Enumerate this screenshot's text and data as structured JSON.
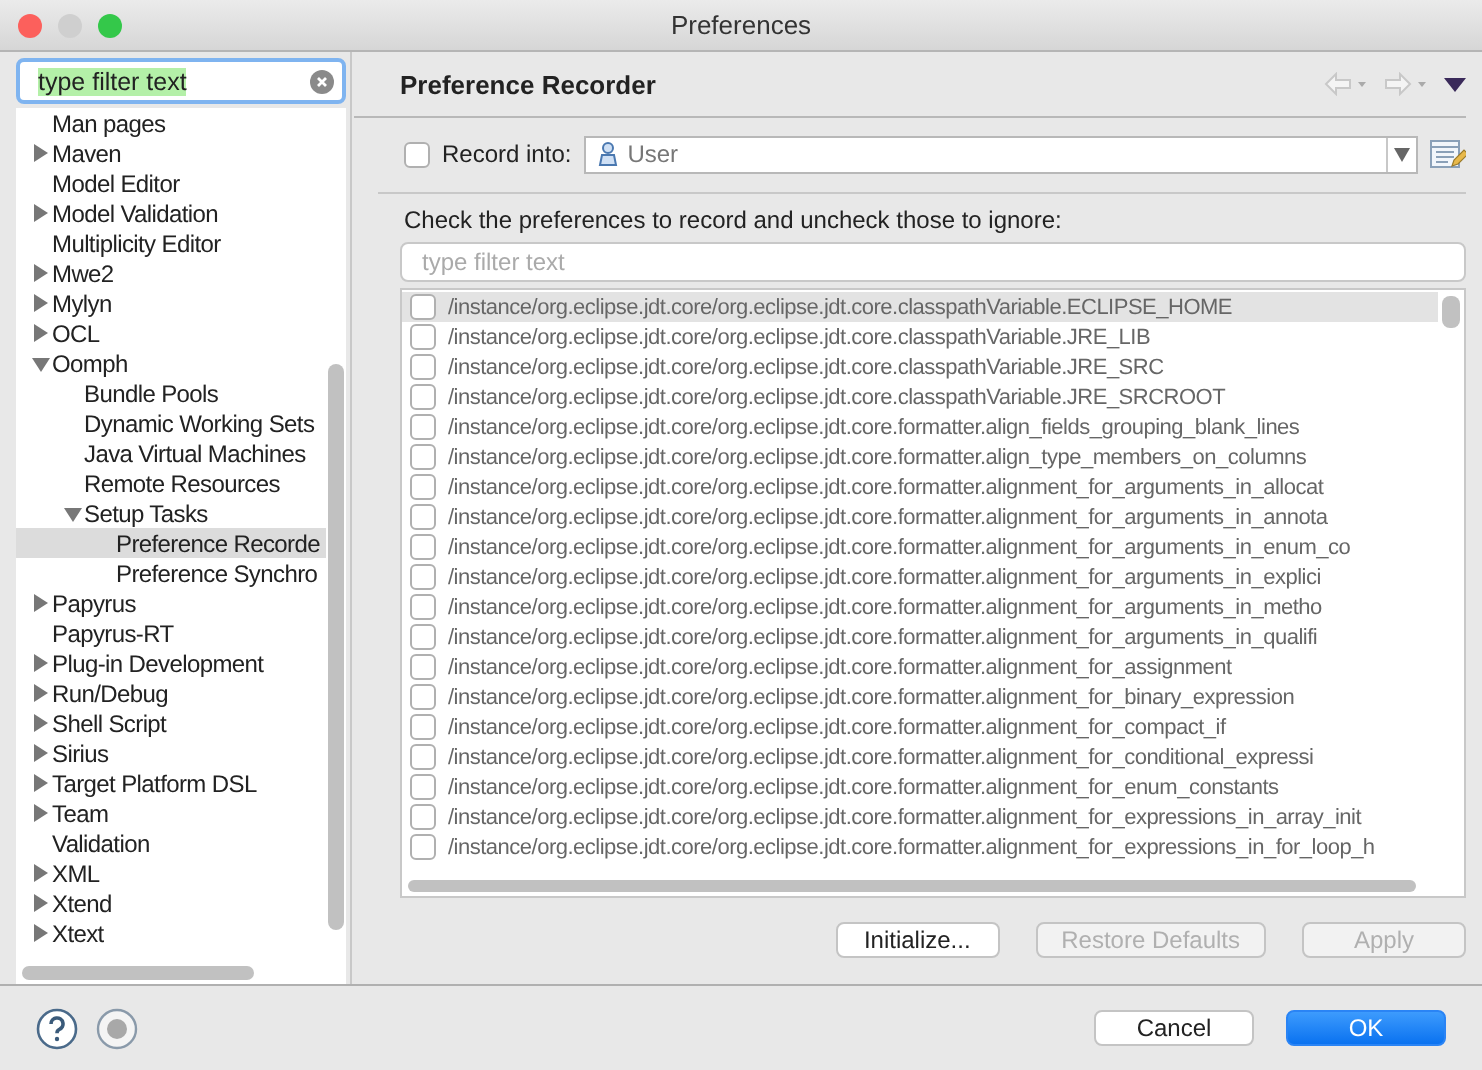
{
  "window": {
    "title": "Preferences"
  },
  "sidebar": {
    "filter": {
      "value": "type filter text"
    },
    "tree": [
      {
        "label": "Man pages"
      },
      {
        "label": "Maven",
        "expanded": false
      },
      {
        "label": "Model Editor"
      },
      {
        "label": "Model Validation",
        "expanded": false
      },
      {
        "label": "Multiplicity Editor"
      },
      {
        "label": "Mwe2",
        "expanded": false
      },
      {
        "label": "Mylyn",
        "expanded": false
      },
      {
        "label": "OCL",
        "expanded": false
      },
      {
        "label": "Oomph",
        "expanded": true,
        "children": [
          {
            "label": "Bundle Pools"
          },
          {
            "label": "Dynamic Working Sets"
          },
          {
            "label": "Java Virtual Machines"
          },
          {
            "label": "Remote Resources"
          },
          {
            "label": "Setup Tasks",
            "expanded": true,
            "children": [
              {
                "label": "Preference Recorde",
                "selected": true
              },
              {
                "label": "Preference Synchro",
                "selected": false
              }
            ]
          }
        ]
      },
      {
        "label": "Papyrus",
        "expanded": false
      },
      {
        "label": "Papyrus-RT"
      },
      {
        "label": "Plug-in Development",
        "expanded": false
      },
      {
        "label": "Run/Debug",
        "expanded": false
      },
      {
        "label": "Shell Script",
        "expanded": false
      },
      {
        "label": "Sirius",
        "expanded": false
      },
      {
        "label": "Target Platform DSL",
        "expanded": false
      },
      {
        "label": "Team",
        "expanded": false
      },
      {
        "label": "Validation"
      },
      {
        "label": "XML",
        "expanded": false
      },
      {
        "label": "Xtend",
        "expanded": false
      },
      {
        "label": "Xtext",
        "expanded": false
      }
    ]
  },
  "page": {
    "title": "Preference Recorder",
    "record": {
      "label": "Record into:",
      "checked": false,
      "target": "User"
    },
    "instruction": "Check the preferences to record and uncheck those to ignore:",
    "filter": {
      "placeholder": "type filter text"
    },
    "preferences": [
      {
        "path": "/instance/org.eclipse.jdt.core/org.eclipse.jdt.core.classpathVariable.ECLIPSE_HOME",
        "checked": false,
        "selected": true
      },
      {
        "path": "/instance/org.eclipse.jdt.core/org.eclipse.jdt.core.classpathVariable.JRE_LIB",
        "checked": false,
        "selected": false
      },
      {
        "path": "/instance/org.eclipse.jdt.core/org.eclipse.jdt.core.classpathVariable.JRE_SRC",
        "checked": false,
        "selected": false
      },
      {
        "path": "/instance/org.eclipse.jdt.core/org.eclipse.jdt.core.classpathVariable.JRE_SRCROOT",
        "checked": false,
        "selected": false
      },
      {
        "path": "/instance/org.eclipse.jdt.core/org.eclipse.jdt.core.formatter.align_fields_grouping_blank_lines",
        "checked": false,
        "selected": false
      },
      {
        "path": "/instance/org.eclipse.jdt.core/org.eclipse.jdt.core.formatter.align_type_members_on_columns",
        "checked": false,
        "selected": false
      },
      {
        "path": "/instance/org.eclipse.jdt.core/org.eclipse.jdt.core.formatter.alignment_for_arguments_in_allocat",
        "checked": false,
        "selected": false
      },
      {
        "path": "/instance/org.eclipse.jdt.core/org.eclipse.jdt.core.formatter.alignment_for_arguments_in_annota",
        "checked": false,
        "selected": false
      },
      {
        "path": "/instance/org.eclipse.jdt.core/org.eclipse.jdt.core.formatter.alignment_for_arguments_in_enum_co",
        "checked": false,
        "selected": false
      },
      {
        "path": "/instance/org.eclipse.jdt.core/org.eclipse.jdt.core.formatter.alignment_for_arguments_in_explici",
        "checked": false,
        "selected": false
      },
      {
        "path": "/instance/org.eclipse.jdt.core/org.eclipse.jdt.core.formatter.alignment_for_arguments_in_metho",
        "checked": false,
        "selected": false
      },
      {
        "path": "/instance/org.eclipse.jdt.core/org.eclipse.jdt.core.formatter.alignment_for_arguments_in_qualifi",
        "checked": false,
        "selected": false
      },
      {
        "path": "/instance/org.eclipse.jdt.core/org.eclipse.jdt.core.formatter.alignment_for_assignment",
        "checked": false,
        "selected": false
      },
      {
        "path": "/instance/org.eclipse.jdt.core/org.eclipse.jdt.core.formatter.alignment_for_binary_expression",
        "checked": false,
        "selected": false
      },
      {
        "path": "/instance/org.eclipse.jdt.core/org.eclipse.jdt.core.formatter.alignment_for_compact_if",
        "checked": false,
        "selected": false
      },
      {
        "path": "/instance/org.eclipse.jdt.core/org.eclipse.jdt.core.formatter.alignment_for_conditional_expressi",
        "checked": false,
        "selected": false
      },
      {
        "path": "/instance/org.eclipse.jdt.core/org.eclipse.jdt.core.formatter.alignment_for_enum_constants",
        "checked": false,
        "selected": false
      },
      {
        "path": "/instance/org.eclipse.jdt.core/org.eclipse.jdt.core.formatter.alignment_for_expressions_in_array_init",
        "checked": false,
        "selected": false
      },
      {
        "path": "/instance/org.eclipse.jdt.core/org.eclipse.jdt.core.formatter.alignment_for_expressions_in_for_loop_h",
        "checked": false,
        "selected": false
      }
    ],
    "buttons": [
      {
        "label": "Initialize...",
        "disabled": false
      },
      {
        "label": "Restore Defaults",
        "disabled": true
      },
      {
        "label": "Apply",
        "disabled": true
      }
    ]
  },
  "footer": {
    "buttons": [
      {
        "label": "Cancel",
        "default": false
      },
      {
        "label": "OK",
        "default": true
      }
    ]
  }
}
